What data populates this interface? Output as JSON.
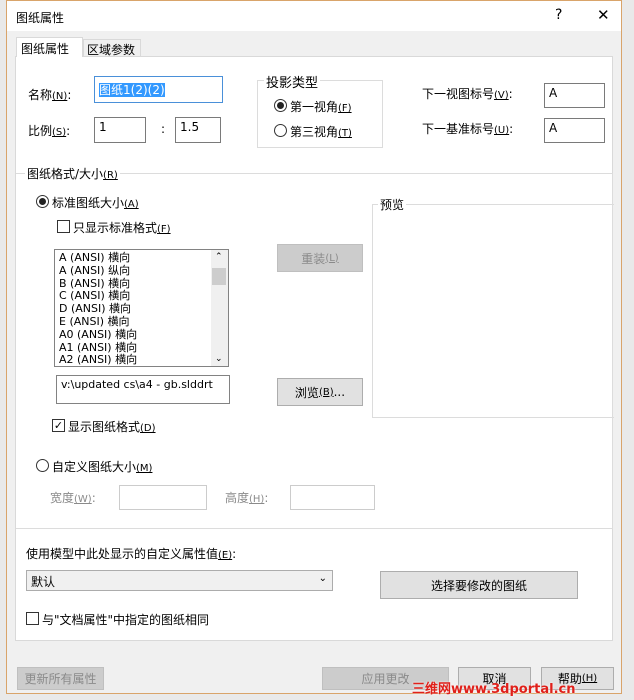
{
  "dialog": {
    "title": "图纸属性",
    "help_label": "?",
    "close_label": "✕"
  },
  "tabs": [
    {
      "label": "图纸属性",
      "selected": true
    },
    {
      "label": "区域参数",
      "selected": false
    }
  ],
  "name": {
    "label": "名称",
    "key": "(N)",
    "suffix": ":",
    "value": "图纸1(2)(2)"
  },
  "scale": {
    "label": "比例",
    "key": "(S)",
    "suffix": ":",
    "value1": "1",
    "separator": ":",
    "value2": "1.5"
  },
  "projection": {
    "title": "投影类型",
    "options": [
      {
        "label": "第一视角",
        "key": "(F)",
        "selected": true
      },
      {
        "label": "第三视角",
        "key": "(T)",
        "selected": false
      }
    ]
  },
  "next_view": {
    "label": "下一视图标号",
    "key": "(V)",
    "suffix": ":",
    "value": "A"
  },
  "next_datum": {
    "label": "下一基准标号",
    "key": "(U)",
    "suffix": ":",
    "value": "A"
  },
  "format": {
    "title": "图纸格式/大小",
    "key": "(R)",
    "standard": {
      "label": "标准图纸大小",
      "key": "(A)",
      "selected": true
    },
    "only_standard": {
      "label": "只显示标准格式",
      "key": "(F)",
      "checked": false
    },
    "sizes": [
      "A (ANSI) 横向",
      "A (ANSI) 纵向",
      "B (ANSI) 横向",
      "C (ANSI) 横向",
      "D (ANSI) 横向",
      "E (ANSI) 横向",
      "A0 (ANSI) 横向",
      "A1 (ANSI) 横向",
      "A2 (ANSI) 横向"
    ],
    "reload": {
      "label": "重装",
      "key": "(L)"
    },
    "path": "v:\\updated cs\\a4 - gb.slddrt",
    "browse": {
      "label": "浏览",
      "key": "(B)",
      "suffix": "..."
    },
    "show_format": {
      "label": "显示图纸格式",
      "key": "(D)",
      "checked": true
    },
    "custom": {
      "label": "自定义图纸大小",
      "key": "(M)",
      "selected": false
    },
    "width": {
      "label": "宽度",
      "key": "(W)",
      "suffix": ":",
      "value": ""
    },
    "height": {
      "label": "高度",
      "key": "(H)",
      "suffix": ":",
      "value": ""
    },
    "preview": "预览"
  },
  "custom_props": {
    "label": "使用模型中此处显示的自定义属性值",
    "key": "(E)",
    "suffix": ":",
    "selected": "默认"
  },
  "select_sheets": "选择要修改的图纸",
  "same_as_doc": {
    "label": "与\"文档属性\"中指定的图纸相同",
    "checked": false
  },
  "buttons": {
    "update_all": "更新所有属性",
    "apply": "应用更改",
    "cancel": "取消",
    "help": "帮助",
    "help_key": "(H)"
  },
  "watermark": "三维网www.3dportal.cn"
}
